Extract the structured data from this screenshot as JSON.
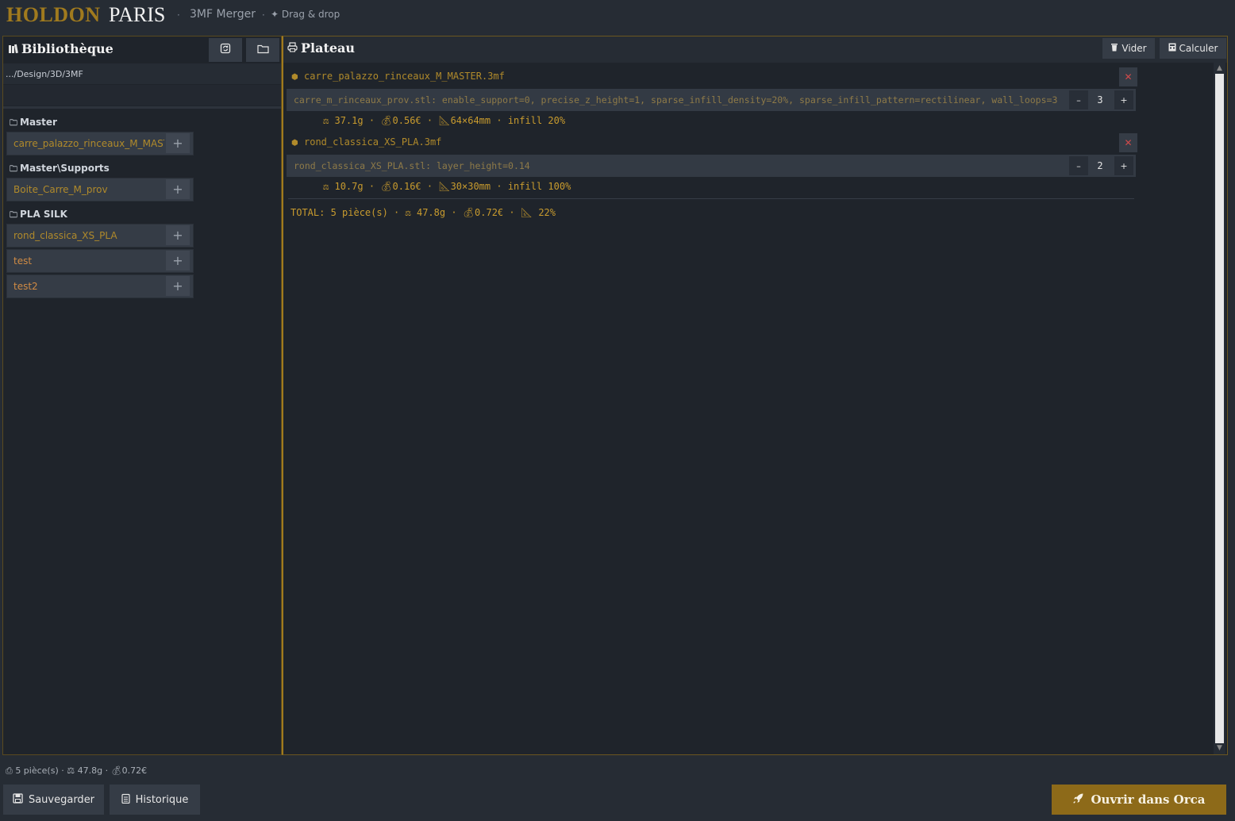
{
  "header": {
    "brand_first": "HOLDON",
    "brand_second": "PARIS",
    "separator": "·",
    "subtitle": "3MF Merger",
    "dnd_hint": "✦ Drag & drop"
  },
  "library": {
    "title": "Bibliothèque",
    "path": ".../Design/3D/3MF",
    "groups": [
      {
        "label": "Master",
        "items": [
          {
            "label": "carre_palazzo_rinceaux_M_MASTER"
          }
        ]
      },
      {
        "label": "Master\\Supports",
        "items": [
          {
            "label": "Boite_Carre_M_prov"
          }
        ]
      },
      {
        "label": "PLA SILK",
        "items": [
          {
            "label": "rond_classica_XS_PLA"
          },
          {
            "label": "test"
          },
          {
            "label": "test2"
          }
        ]
      }
    ],
    "add_glyph": "+"
  },
  "plate": {
    "title": "Plateau",
    "clear_label": "Vider",
    "calc_label": "Calculer",
    "remove_glyph": "✕",
    "minus_glyph": "–",
    "plus_glyph": "+",
    "files": [
      {
        "name": "carre_palazzo_rinceaux_M_MASTER.3mf",
        "params": "carre_m_rinceaux_prov.stl: enable_support=0, precise_z_height=1, sparse_infill_density=20%, sparse_infill_pattern=rectilinear, wall_loops=3",
        "quantity": "3",
        "weight": "37.1g",
        "cost": "0.56€",
        "size": "64×64mm",
        "infill": "infill 20%"
      },
      {
        "name": "rond_classica_XS_PLA.3mf",
        "params": "rond_classica_XS_PLA.stl: layer_height=0.14",
        "quantity": "2",
        "weight": "10.7g",
        "cost": "0.16€",
        "size": "30×30mm",
        "infill": "infill 100%"
      }
    ],
    "total": {
      "pieces": "TOTAL: 5 pièce(s)",
      "weight": "47.8g",
      "cost": "0.72€",
      "percent": "22%"
    }
  },
  "footer": {
    "summary_pieces": "5 pièce(s)",
    "summary_weight": "47.8g",
    "summary_cost": "0.72€",
    "save_label": "Sauvegarder",
    "history_label": "Historique",
    "orca_label": "Ouvrir dans Orca"
  },
  "colors": {
    "accent_gold": "#c89b2e",
    "panel_bg": "#1f242b",
    "app_bg": "#262c34",
    "primary_button": "#8d6a19",
    "remove_red": "#d04a4a"
  },
  "icons": {
    "library": "books-icon",
    "refresh": "refresh-icon",
    "folder": "folder-icon",
    "plate": "printer-icon",
    "clear": "trash-icon",
    "calc": "calculator-icon",
    "file": "package-icon",
    "weight": "scale-icon",
    "cost": "money-bag-icon",
    "size": "ruler-icon",
    "save": "floppy-icon",
    "history": "clipboard-icon",
    "orca": "rocket-icon"
  }
}
